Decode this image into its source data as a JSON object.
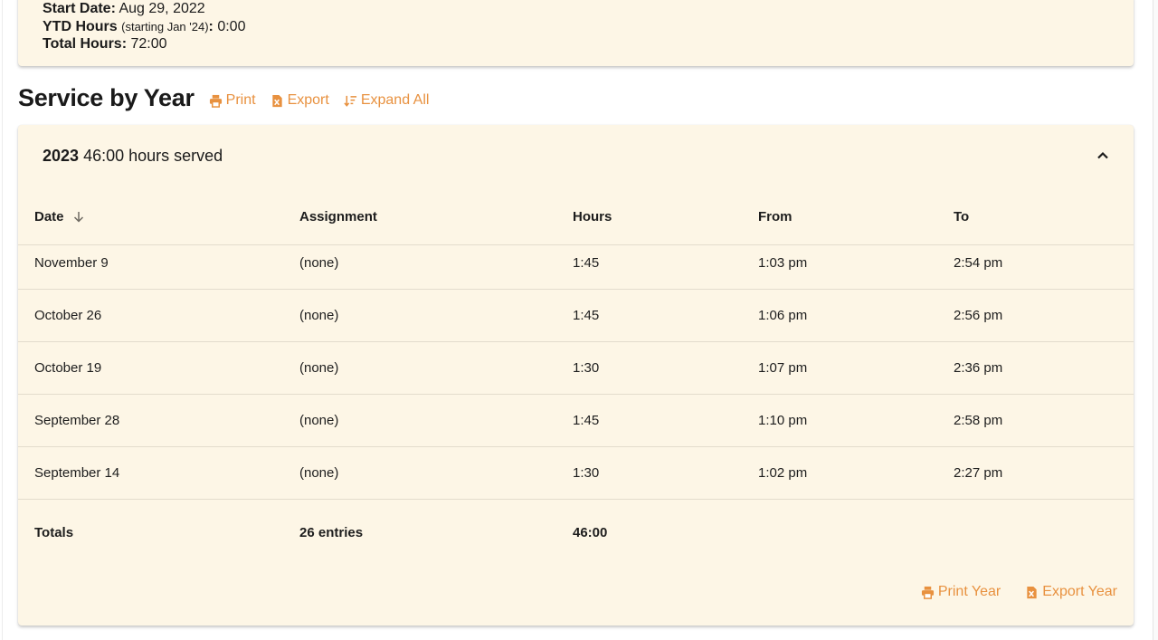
{
  "summary": {
    "start_date_label": "Start Date:",
    "start_date_value": "Aug 29, 2022",
    "ytd_label": "YTD Hours",
    "ytd_note": "(starting Jan '24)",
    "ytd_colon": ":",
    "ytd_value": "0:00",
    "total_label": "Total Hours:",
    "total_value": "72:00"
  },
  "section": {
    "title": "Service by Year",
    "print_label": "Print",
    "export_label": "Export",
    "expand_label": "Expand All"
  },
  "year_group": {
    "year": "2023",
    "hours_text": "46:00 hours served",
    "columns": [
      "Date",
      "Assignment",
      "Hours",
      "From",
      "To"
    ],
    "rows": [
      {
        "date": "November 9",
        "assignment": "(none)",
        "hours": "1:45",
        "from": "1:03 pm",
        "to": "2:54 pm"
      },
      {
        "date": "October 26",
        "assignment": "(none)",
        "hours": "1:45",
        "from": "1:06 pm",
        "to": "2:56 pm"
      },
      {
        "date": "October 19",
        "assignment": "(none)",
        "hours": "1:30",
        "from": "1:07 pm",
        "to": "2:36 pm"
      },
      {
        "date": "September 28",
        "assignment": "(none)",
        "hours": "1:45",
        "from": "1:10 pm",
        "to": "2:58 pm"
      },
      {
        "date": "September 14",
        "assignment": "(none)",
        "hours": "1:30",
        "from": "1:02 pm",
        "to": "2:27 pm"
      }
    ],
    "totals": {
      "label": "Totals",
      "entries": "26 entries",
      "hours": "46:00"
    },
    "print_year_label": "Print Year",
    "export_year_label": "Export Year"
  },
  "colors": {
    "accent": "#e8913f",
    "card_bg": "#fdf6e6"
  },
  "icons": [
    "printer-icon",
    "excel-file-icon",
    "sort-expand-icon",
    "chevron-up-icon",
    "arrow-down-icon"
  ]
}
